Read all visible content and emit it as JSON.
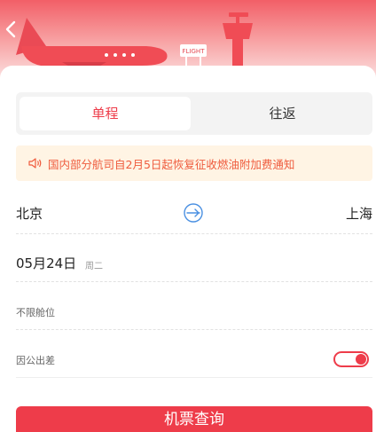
{
  "header": {
    "back_icon": "chevron-left-icon",
    "sign_text": "FLIGHT"
  },
  "trip_type": {
    "tabs": [
      {
        "label": "单程",
        "selected": true
      },
      {
        "label": "往返",
        "selected": false
      }
    ]
  },
  "notice": {
    "icon": "speaker-icon",
    "text": "国内部分航司自2月5日起恢复征收燃油附加费通知"
  },
  "route": {
    "from_city": "北京",
    "to_city": "上海",
    "swap_icon": "swap-plane-icon"
  },
  "date": {
    "value": "05月24日",
    "weekday": "周二"
  },
  "cabin": {
    "label": "不限舱位"
  },
  "business_trip": {
    "label": "因公出差",
    "enabled": true
  },
  "search_button": {
    "label": "机票查询"
  },
  "colors": {
    "accent": "#ee3c4a",
    "notice_text": "#ef5b3d",
    "notice_bg": "#fff4e4"
  }
}
